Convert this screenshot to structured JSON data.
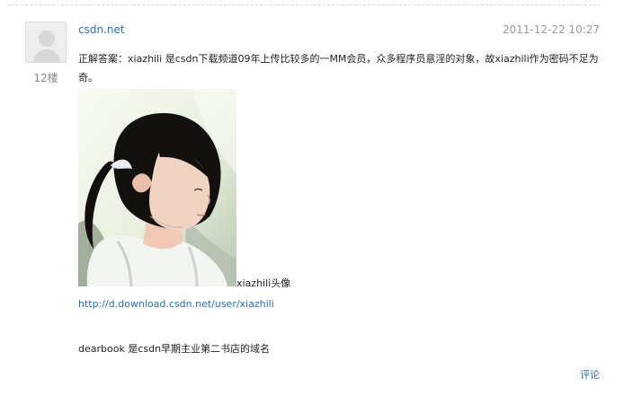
{
  "comment": {
    "author": "csdn.net",
    "timestamp": "2011-12-22 10:27",
    "floor": "12楼",
    "body_text": "正解答案：xiazhili 是csdn下载频道09年上传比较多的一MM会员，众多程序员意淫的对象，故xiazhili作为密码不足为奇。",
    "image_caption": "xiazhili头像",
    "link": "http://d.download.csdn.net/user/xiazhili",
    "note": "dearbook 是csdn早期主业第二书店的域名",
    "comment_action": "评论"
  },
  "colors": {
    "link": "#2f6fa6",
    "muted": "#9a9a9a",
    "text": "#222222"
  }
}
